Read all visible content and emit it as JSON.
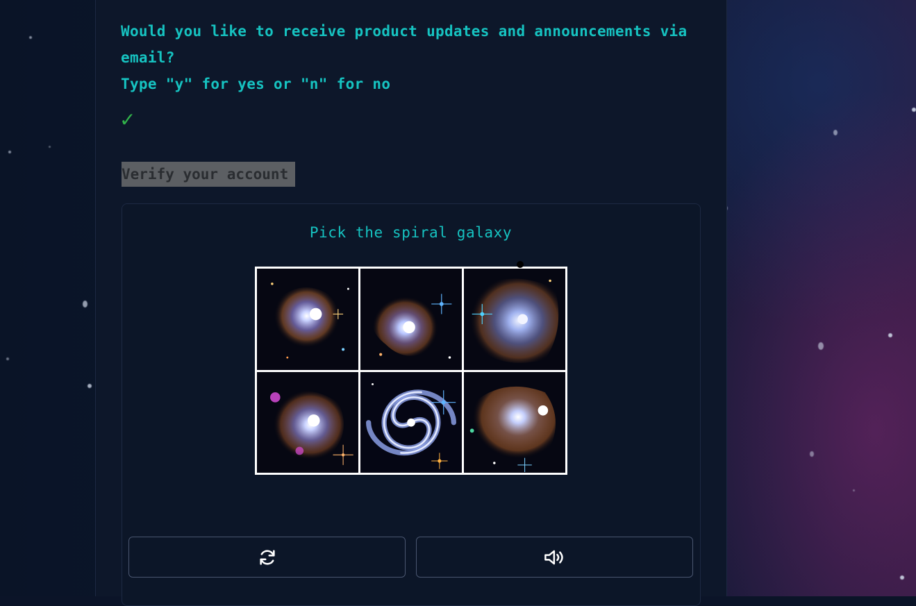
{
  "form": {
    "question_line1": "Would you like to receive product updates and announcements via email?",
    "question_line2": "Type \"y\" for yes or \"n\" for no",
    "answer_status_icon": "checkmark-icon",
    "answer_status_glyph": "✓",
    "answer_status_color": "#31b24a"
  },
  "verify": {
    "heading": "Verify your account"
  },
  "captcha": {
    "prompt": "Pick the spiral galaxy",
    "tiles": [
      {
        "id": "galaxy-tile-1",
        "kind": "irregular"
      },
      {
        "id": "galaxy-tile-2",
        "kind": "irregular"
      },
      {
        "id": "galaxy-tile-3",
        "kind": "irregular"
      },
      {
        "id": "galaxy-tile-4",
        "kind": "irregular"
      },
      {
        "id": "galaxy-tile-5",
        "kind": "spiral"
      },
      {
        "id": "galaxy-tile-6",
        "kind": "irregular"
      }
    ],
    "refresh_icon": "refresh-icon",
    "audio_icon": "speaker-icon"
  },
  "colors": {
    "accent": "#16c3c1",
    "panel": "#0d172a",
    "page_bg": "#0b1428"
  }
}
